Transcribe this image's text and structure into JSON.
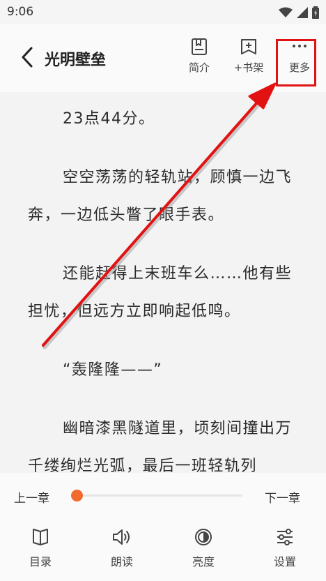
{
  "status_bar": {
    "time": "9:06"
  },
  "header": {
    "title": "光明壁垒",
    "intro_label": "简介",
    "add_shelf_label": "+书架",
    "more_label": "更多"
  },
  "content": {
    "paragraphs": [
      "23点44分。",
      "空空荡荡的轻轨站，顾慎一边飞奔，一边低头瞥了眼手表。",
      "还能赶得上末班车么……他有些担忧，但远方立即响起低鸣。",
      "“轰隆隆——”",
      "幽暗漆黑隧道里，顷刻间撞出万千缕绚烂光弧，最后一班轻轨列"
    ]
  },
  "chapter_nav": {
    "prev_label": "上一章",
    "next_label": "下一章",
    "progress": 0
  },
  "toolbar": {
    "toc_label": "目录",
    "read_aloud_label": "朗读",
    "brightness_label": "亮度",
    "settings_label": "设置"
  },
  "colors": {
    "accent": "#f26a2e",
    "annotation": "#e21212"
  }
}
